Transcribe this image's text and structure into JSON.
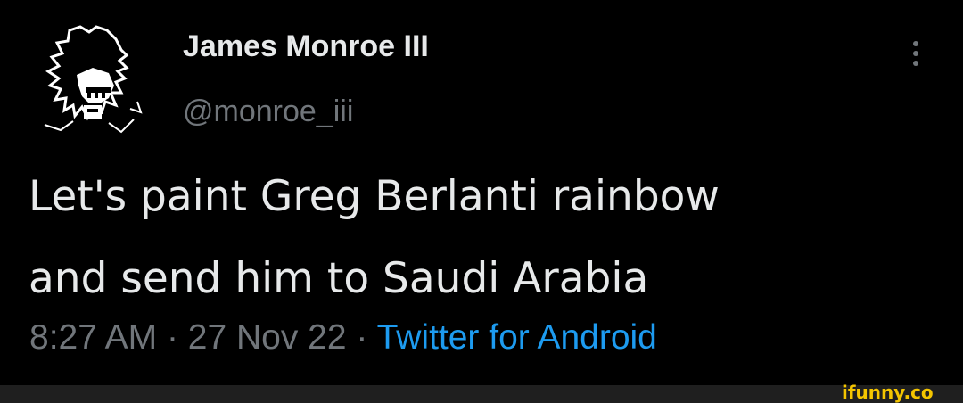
{
  "tweet": {
    "author": {
      "display_name": "James Monroe III",
      "handle": "@monroe_iii",
      "avatar_icon": "pixel-art-character-avatar"
    },
    "more_icon": "vertical-ellipsis-icon",
    "text_lines": [
      "Let's paint Greg Berlanti rainbow",
      "and send him to Saudi Arabia"
    ],
    "time": "8:27 AM",
    "separator": "·",
    "date": "27 Nov 22",
    "source": "Twitter for Android"
  },
  "watermark": {
    "text": "ifunny.co"
  },
  "colors": {
    "background": "#000000",
    "primary_text": "#e7e9ea",
    "secondary_text": "#71767b",
    "link": "#1d9bf0",
    "watermark": "#f4c500"
  }
}
